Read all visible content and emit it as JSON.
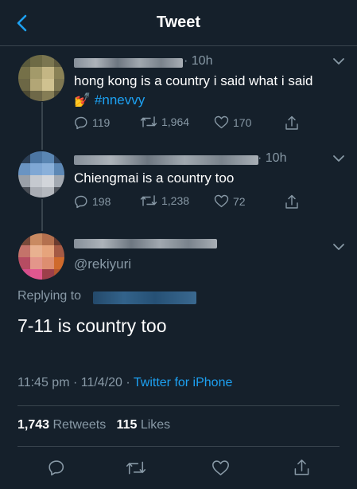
{
  "header": {
    "title": "Tweet",
    "back_icon": "chevron-left-icon",
    "accent": "#1da1f2"
  },
  "thread": [
    {
      "time": "· 10h",
      "text": "hong kong is a country i said what i said",
      "emoji": "💅",
      "hashtag": "#nnevvy",
      "replies": "119",
      "retweets": "1,964",
      "likes": "170"
    },
    {
      "time": "· 10h",
      "text": "Chiengmai is a country too",
      "replies": "198",
      "retweets": "1,238",
      "likes": "72"
    }
  ],
  "main_tweet": {
    "handle": "@rekiyuri",
    "replying_label": "Replying to",
    "text": "7-11 is country too",
    "timestamp": "11:45 pm · 11/4/20 · ",
    "source": "Twitter for iPhone",
    "retweet_count": "1,743",
    "retweet_label": "Retweets",
    "like_count": "115",
    "like_label": "Likes"
  },
  "colors": {
    "background": "#15202b",
    "secondary_text": "#8899a6",
    "divider": "#38444d",
    "link": "#1da1f2"
  }
}
